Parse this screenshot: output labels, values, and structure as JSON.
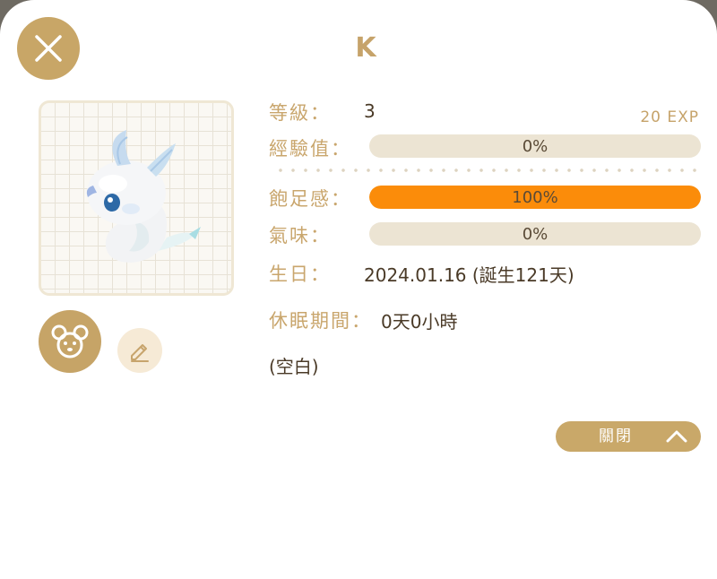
{
  "pet": {
    "name": "K",
    "image": "dragon-pet"
  },
  "stats": {
    "level_label": "等級：",
    "level_value": "3",
    "exp_total": "20 EXP",
    "exp_label": "經驗值：",
    "exp_progress": 0,
    "exp_text": "0%",
    "satiety_label": "飽足感：",
    "satiety_progress": 100,
    "satiety_text": "100%",
    "odor_label": "氣味：",
    "odor_progress": 0,
    "odor_text": "0%",
    "birthday_label": "生日：",
    "birthday_value": "2024.01.16 (誕生121天)",
    "sleep_label": "休眠期間：",
    "sleep_value": "0天0小時"
  },
  "note": "(空白)",
  "buttons": {
    "close_icon": "close-icon",
    "mouse_icon": "mouse-icon",
    "edit_icon": "pencil-icon",
    "collapse_label": "關閉",
    "collapse_icon": "chevron-up-icon"
  },
  "colors": {
    "accent": "#c8a667",
    "satiety_fill": "#fb8c0a",
    "bar_track": "#ece4d3",
    "label": "#c9a66d",
    "text": "#4a3a27"
  }
}
